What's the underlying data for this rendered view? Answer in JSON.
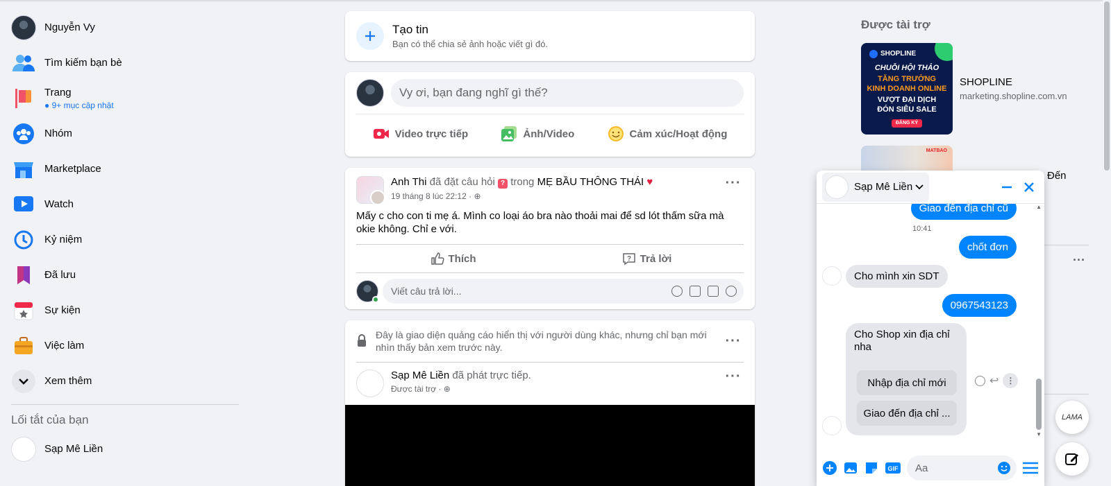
{
  "sidebar": {
    "items": [
      {
        "label": "Nguyễn Vy"
      },
      {
        "label": "Tìm kiếm bạn bè"
      },
      {
        "label": "Trang",
        "sub": "9+ mục cập nhật"
      },
      {
        "label": "Nhóm"
      },
      {
        "label": "Marketplace"
      },
      {
        "label": "Watch"
      },
      {
        "label": "Kỷ niệm"
      },
      {
        "label": "Đã lưu"
      },
      {
        "label": "Sự kiện"
      },
      {
        "label": "Việc làm"
      },
      {
        "label": "Xem thêm"
      }
    ],
    "shortcuts_heading": "Lối tắt của bạn",
    "shortcuts": [
      {
        "label": "Sạp Mê Liền"
      }
    ]
  },
  "story": {
    "title": "Tạo tin",
    "subtitle": "Bạn có thể chia sẻ ảnh hoặc viết gì đó."
  },
  "composer": {
    "placeholder": "Vy ơi, bạn đang nghĩ gì thế?",
    "actions": {
      "live": "Video trực tiếp",
      "photo": "Ảnh/Video",
      "feeling": "Cảm xúc/Hoạt động"
    }
  },
  "post1": {
    "author": "Anh Thi",
    "action": "đã đặt câu hỏi",
    "in_word": "trong",
    "group": "MẸ BẦU THÔNG THÁI",
    "time": "19 tháng 8 lúc 22:12 ·",
    "text": "Mấy c cho con ti mẹ á. Mình co loại áo bra nào thoải mai để sd lót thấm sữa mà okie không. Chỉ e với.",
    "like": "Thích",
    "reply": "Trả lời",
    "reply_placeholder": "Viết câu trả lời..."
  },
  "post2": {
    "preview_note": "Đây là giao diện quảng cáo hiển thị với người dùng khác, nhưng chỉ bạn mới nhìn thấy bản xem trước này.",
    "author": "Sạp Mê Liền",
    "action": "đã phát trực tiếp.",
    "sponsored": "Được tài trợ ·"
  },
  "sponsored": {
    "heading": "Được tài trợ",
    "ads": [
      {
        "name": "SHOPLINE",
        "url": "marketing.shopline.com.vn",
        "img_lines": [
          "SHOPLINE",
          "CHUỖI HỘI THẢO",
          "TĂNG TRƯỞNG",
          "KINH DOANH ONLINE",
          "VƯỢT ĐẠI DỊCH",
          "ĐÓN SIÊU SALE",
          "ĐĂNG KÝ"
        ]
      },
      {
        "name": "Đến",
        "img_lines": [
          "MATBAO"
        ]
      }
    ]
  },
  "chat": {
    "name": "Sạp Mê Liền",
    "messages": {
      "m1": "Giao đến địa chỉ cũ",
      "time": "10:41",
      "m2": "chốt đơn",
      "m3": "Cho mình xin  SDT",
      "m4": "0967543123",
      "m5": "Cho Shop xin địa chỉ nha"
    },
    "quick_replies": [
      "Nhập địa chỉ mới",
      "Giao đến địa chỉ ..."
    ],
    "input_placeholder": "Aa"
  },
  "float": {
    "lama": "LAMA"
  },
  "colors": {
    "brand": "#1877f2",
    "messenger": "#0084ff",
    "bg": "#f0f2f5"
  }
}
